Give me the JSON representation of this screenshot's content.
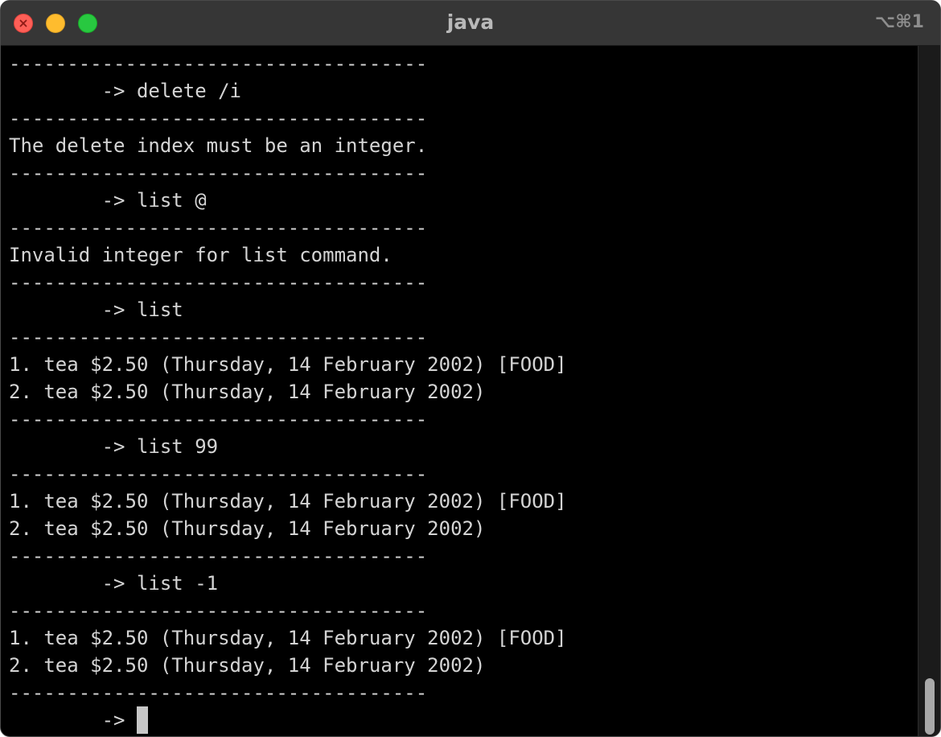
{
  "window": {
    "title": "java",
    "shortcut": "⌥⌘1"
  },
  "terminal": {
    "lines": [
      "------------------------------------",
      "        -> delete /i",
      "------------------------------------",
      "The delete index must be an integer.",
      "------------------------------------",
      "        -> list @",
      "------------------------------------",
      "Invalid integer for list command.",
      "------------------------------------",
      "        -> list",
      "------------------------------------",
      "1. tea $2.50 (Thursday, 14 February 2002) [FOOD]",
      "2. tea $2.50 (Thursday, 14 February 2002)",
      "------------------------------------",
      "        -> list 99",
      "------------------------------------",
      "1. tea $2.50 (Thursday, 14 February 2002) [FOOD]",
      "2. tea $2.50 (Thursday, 14 February 2002)",
      "------------------------------------",
      "        -> list -1",
      "------------------------------------",
      "1. tea $2.50 (Thursday, 14 February 2002) [FOOD]",
      "2. tea $2.50 (Thursday, 14 February 2002)",
      "------------------------------------"
    ],
    "prompt": "        -> "
  },
  "icons": {
    "close": "close-icon",
    "minimize": "minimize-icon",
    "zoom": "zoom-icon"
  },
  "colors": {
    "background": "#000000",
    "text": "#d4d4d4",
    "titlebar": "#363636",
    "close": "#fe5f57",
    "minimize": "#febc2e",
    "zoom": "#28c840"
  }
}
